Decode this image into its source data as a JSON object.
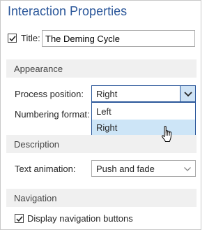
{
  "panel": {
    "title": "Interaction Properties",
    "title_field": {
      "label": "Title:",
      "checked": true,
      "value": "The Deming Cycle"
    }
  },
  "appearance": {
    "header": "Appearance",
    "process_position": {
      "label": "Process position:",
      "value": "Right",
      "options": [
        "Left",
        "Right"
      ],
      "highlighted_option": "Right"
    },
    "numbering_format": {
      "label": "Numbering format:"
    }
  },
  "description": {
    "header": "Description",
    "text_animation": {
      "label": "Text animation:",
      "value": "Push and fade"
    }
  },
  "navigation": {
    "header": "Navigation",
    "display_nav": {
      "label": "Display navigation buttons",
      "checked": true
    }
  },
  "icons": {
    "checkbox_check": "check-icon",
    "dropdown_chevron": "chevron-down-icon",
    "cursor": "hand-pointer-icon"
  },
  "colors": {
    "title": "#2b579a",
    "section_bg": "#f0f0f0",
    "highlight": "#cde5f7",
    "focus_border": "#2b579a"
  }
}
